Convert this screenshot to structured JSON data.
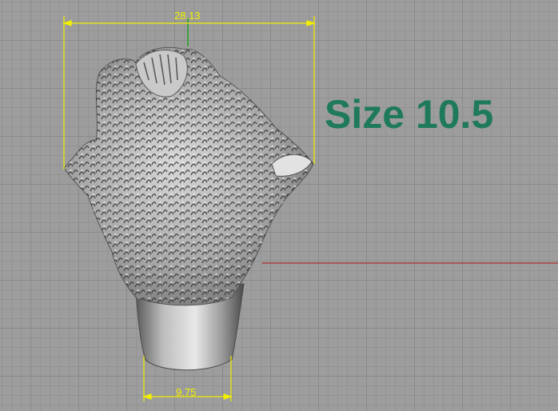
{
  "viewport": {
    "background_color": "#9d9d9d",
    "grid_color": "#8a8a8a",
    "x_axis_color": "#b03030",
    "y_axis_color": "#20a020"
  },
  "model": {
    "name": "bear-head-ring"
  },
  "dimensions": {
    "top_width": "28.13",
    "bottom_width": "9.75",
    "line_color": "#f2f000"
  },
  "annotation": {
    "size_text": "Size 10.5",
    "color": "#1e7a5a"
  }
}
